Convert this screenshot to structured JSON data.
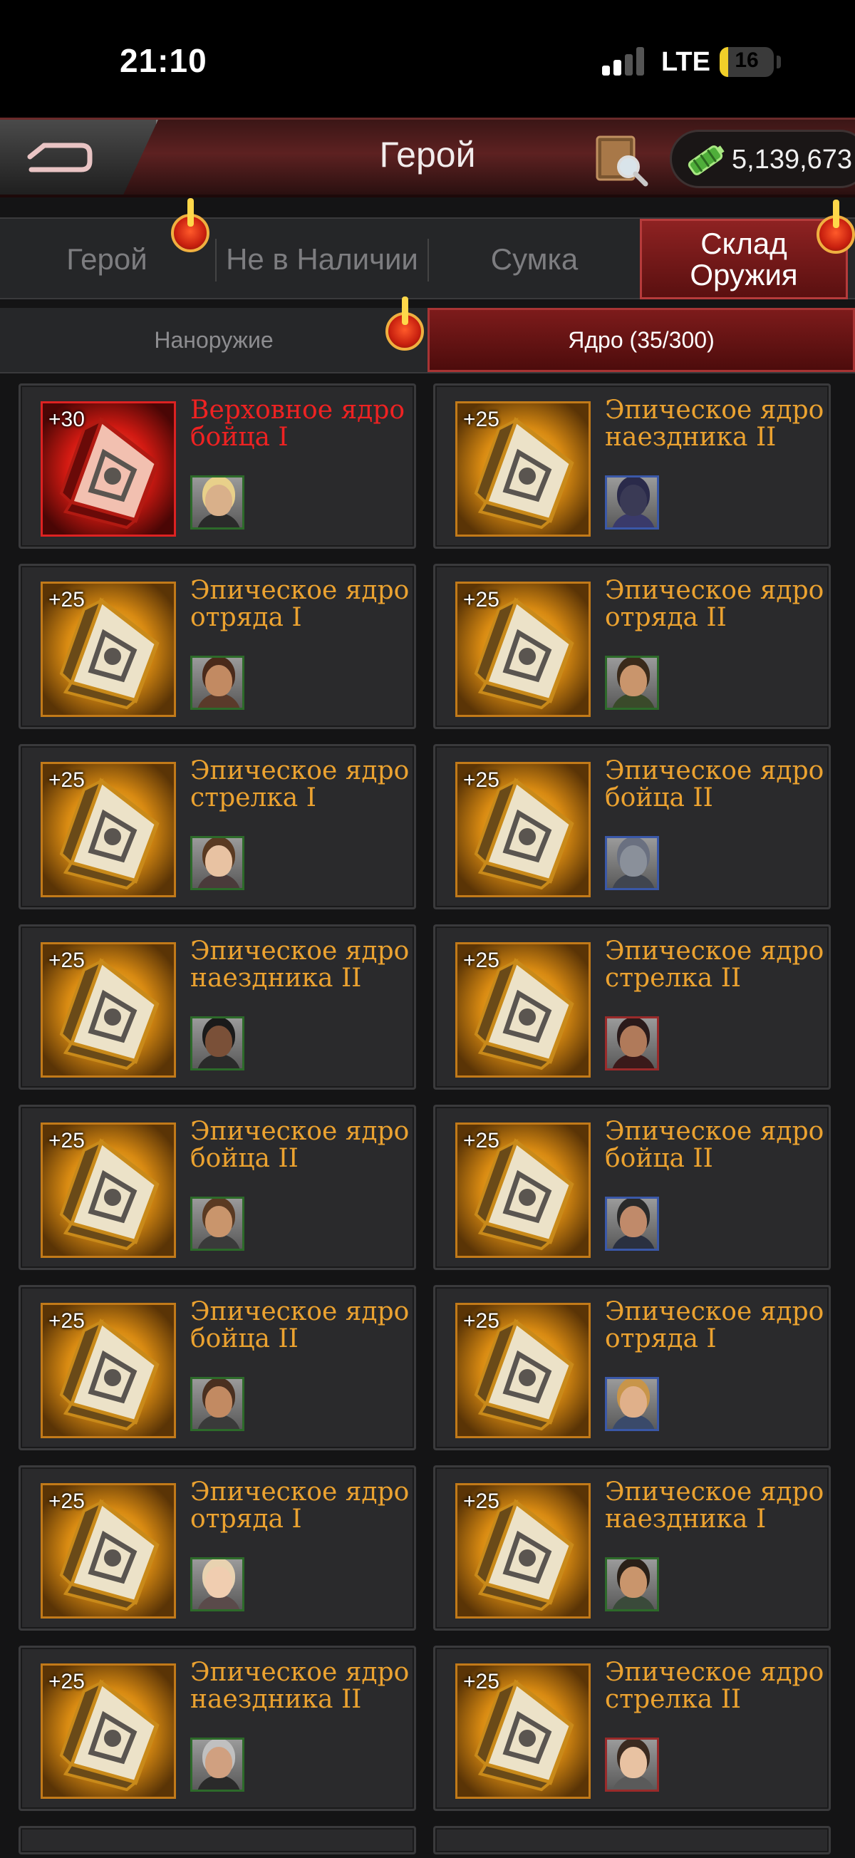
{
  "status_bar": {
    "time": "21:10",
    "network": "LTE",
    "battery": "16",
    "battery_level": 0.16,
    "signal_bars": 2
  },
  "header": {
    "title": "Герой",
    "resource_value": "5,139,673",
    "back_icon": "back-arrow-icon",
    "book_icon": "book-magnifier-icon",
    "resource_icon": "battery-cell-icon"
  },
  "tabs_main": [
    {
      "label": "Герой",
      "badge": true
    },
    {
      "label": "Не в Наличии",
      "badge": false
    },
    {
      "label": "Сумка",
      "badge": false
    },
    {
      "label": "Склад\nОружия",
      "badge": true,
      "active": true
    }
  ],
  "tabs_sub": [
    {
      "label": "Наноружие",
      "badge": true
    },
    {
      "label": "Ядро (35/300)",
      "active": true
    }
  ],
  "colors": {
    "epic": "#eba230",
    "supreme": "#ee2222",
    "accent_red": "#8e2222"
  },
  "cards": [
    {
      "level": "+30",
      "name": "Верховное ядро бойца I",
      "rarity": "supreme",
      "avatar": {
        "frame": "green",
        "hair": "#e8d08a",
        "skin": "#d9b08a",
        "cloth": "#2a2a2a"
      }
    },
    {
      "level": "+25",
      "name": "Эпическое ядро наездника II",
      "rarity": "epic",
      "avatar": {
        "frame": "blue",
        "hair": "#2a2a4a",
        "skin": "#3a3a55",
        "cloth": "#3a3a6a"
      }
    },
    {
      "level": "+25",
      "name": "Эпическое ядро отряда I",
      "rarity": "epic",
      "avatar": {
        "frame": "green",
        "hair": "#4a2a1a",
        "skin": "#c28a62",
        "cloth": "#5a3a2a"
      }
    },
    {
      "level": "+25",
      "name": "Эпическое ядро отряда II",
      "rarity": "epic",
      "avatar": {
        "frame": "green",
        "hair": "#3a2a1a",
        "skin": "#c9956c",
        "cloth": "#3a4a2a"
      }
    },
    {
      "level": "+25",
      "name": "Эпическое ядро стрелка I",
      "rarity": "epic",
      "avatar": {
        "frame": "green",
        "hair": "#5a3a22",
        "skin": "#e8c2a2",
        "cloth": "#4a3a3a"
      }
    },
    {
      "level": "+25",
      "name": "Эпическое ядро бойца II",
      "rarity": "epic",
      "avatar": {
        "frame": "blue",
        "hair": "#6a7080",
        "skin": "#8a909a",
        "cloth": "#40454f"
      }
    },
    {
      "level": "+25",
      "name": "Эпическое ядро наездника II",
      "rarity": "epic",
      "avatar": {
        "frame": "green",
        "hair": "#1a1a1a",
        "skin": "#7a5038",
        "cloth": "#2a2a2a"
      }
    },
    {
      "level": "+25",
      "name": "Эпическое ядро стрелка II",
      "rarity": "epic",
      "avatar": {
        "frame": "red",
        "hair": "#2a1a1a",
        "skin": "#b07a5a",
        "cloth": "#3a1a1a"
      }
    },
    {
      "level": "+25",
      "name": "Эпическое ядро бойца II",
      "rarity": "epic",
      "avatar": {
        "frame": "green",
        "hair": "#5a3a22",
        "skin": "#c9956c",
        "cloth": "#3a3a3a"
      }
    },
    {
      "level": "+25",
      "name": "Эпическое ядро бойца II",
      "rarity": "epic",
      "avatar": {
        "frame": "blue",
        "hair": "#2a2a2a",
        "skin": "#c08a6a",
        "cloth": "#2a3040"
      }
    },
    {
      "level": "+25",
      "name": "Эпическое ядро бойца II",
      "rarity": "epic",
      "avatar": {
        "frame": "green",
        "hair": "#4a3020",
        "skin": "#c28a62",
        "cloth": "#3a3a3a"
      }
    },
    {
      "level": "+25",
      "name": "Эпическое ядро отряда I",
      "rarity": "epic",
      "avatar": {
        "frame": "blue",
        "hair": "#c8954a",
        "skin": "#e0b08a",
        "cloth": "#3a4a6a"
      }
    },
    {
      "level": "+25",
      "name": "Эпическое ядро отряда I",
      "rarity": "epic",
      "avatar": {
        "frame": "green",
        "hair": "#e8d2b0",
        "skin": "#f0cdb0",
        "cloth": "#5a4a4a"
      }
    },
    {
      "level": "+25",
      "name": "Эпическое ядро наездника I",
      "rarity": "epic",
      "avatar": {
        "frame": "green",
        "hair": "#2a2018",
        "skin": "#c9956c",
        "cloth": "#3a4a3a"
      }
    },
    {
      "level": "+25",
      "name": "Эпическое ядро наездника II",
      "rarity": "epic",
      "avatar": {
        "frame": "green",
        "hair": "#c0c0c0",
        "skin": "#d0a080",
        "cloth": "#2a2a2a"
      }
    },
    {
      "level": "+25",
      "name": "Эпическое ядро стрелка II",
      "rarity": "epic",
      "avatar": {
        "frame": "red",
        "hair": "#3a2a20",
        "skin": "#e8c2a2",
        "cloth": "#5a5a5a"
      }
    }
  ]
}
